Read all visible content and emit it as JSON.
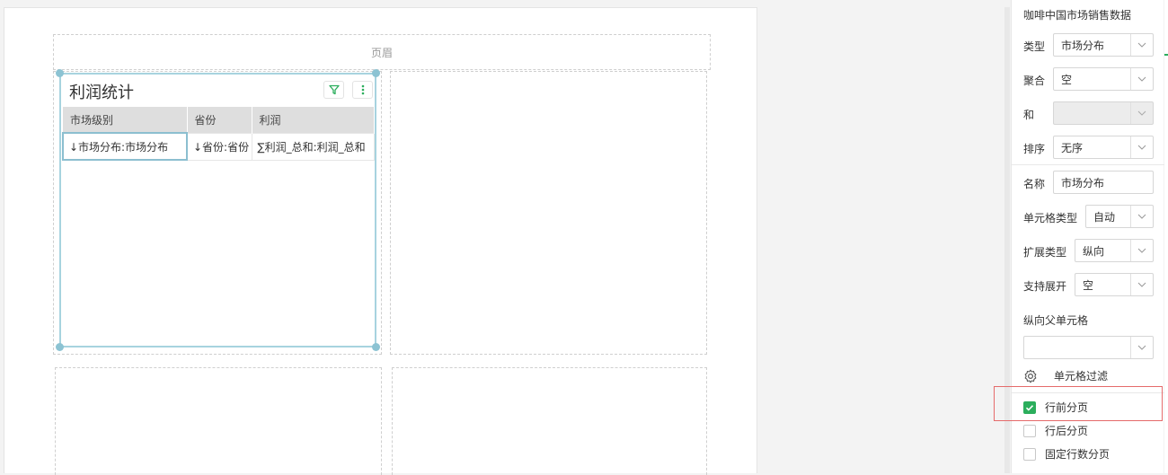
{
  "page": {
    "header_label": "页眉"
  },
  "widget": {
    "title": "利润统计",
    "columns": [
      "市场级别",
      "省份",
      "利润"
    ],
    "rows": [
      [
        "↓市场分布:市场分布",
        "↓省份:省份",
        "∑利润_总和:利润_总和"
      ]
    ]
  },
  "panel": {
    "dataset_title": "咖啡中国市场销售数据",
    "type_label": "类型",
    "type_value": "市场分布",
    "agg_label": "聚合",
    "agg_value": "空",
    "and_label": "和",
    "and_value": "",
    "sort_label": "排序",
    "sort_value": "无序",
    "name_label": "名称",
    "name_value": "市场分布",
    "cell_type_label": "单元格类型",
    "cell_type_value": "自动",
    "expand_type_label": "扩展类型",
    "expand_type_value": "纵向",
    "support_expand_label": "支持展开",
    "support_expand_value": "空",
    "parent_cell_label": "纵向父单元格",
    "parent_cell_value": "",
    "cell_filter_label": "单元格过滤",
    "checkboxes": [
      {
        "label": "行前分页",
        "checked": true
      },
      {
        "label": "行后分页",
        "checked": false
      },
      {
        "label": "固定行数分页",
        "checked": false
      }
    ]
  },
  "colors": {
    "accent": "#2bae5c",
    "selection": "#8cc3d3",
    "highlight": "#e56b6b"
  }
}
